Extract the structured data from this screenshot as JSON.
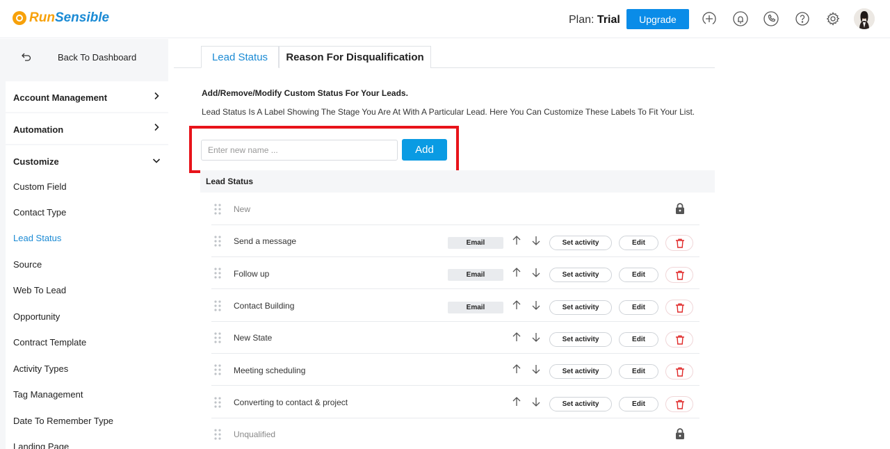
{
  "header": {
    "logo_run": "Run",
    "logo_sensible": "Sensible",
    "plan_label": "Plan:",
    "plan_value": "Trial",
    "upgrade_label": "Upgrade",
    "icons": [
      "add-circle-icon",
      "bell-icon",
      "phone-icon",
      "help-icon",
      "gear-icon"
    ]
  },
  "sidebar": {
    "back_label": "Back To Dashboard",
    "sections": [
      {
        "label": "Account Management",
        "expanded": false
      },
      {
        "label": "Automation",
        "expanded": false
      },
      {
        "label": "Customize",
        "expanded": true
      }
    ],
    "items": [
      {
        "label": "Custom Field",
        "active": false
      },
      {
        "label": "Contact Type",
        "active": false
      },
      {
        "label": "Lead Status",
        "active": true
      },
      {
        "label": "Source",
        "active": false
      },
      {
        "label": "Web To Lead",
        "active": false
      },
      {
        "label": "Opportunity",
        "active": false
      },
      {
        "label": "Contract Template",
        "active": false
      },
      {
        "label": "Activity Types",
        "active": false
      },
      {
        "label": "Tag Management",
        "active": false
      },
      {
        "label": "Date To Remember Type",
        "active": false
      },
      {
        "label": "Landing Page",
        "active": false
      }
    ]
  },
  "tabs": [
    {
      "label": "Lead Status",
      "active": true
    },
    {
      "label": "Reason For Disqualification",
      "active": false
    }
  ],
  "main": {
    "heading": "Add/Remove/Modify Custom Status For Your Leads.",
    "description": "Lead Status Is A Label Showing The Stage You Are At With A Particular Lead. Here You Can Customize These Labels To Fit Your List.",
    "input_placeholder": "Enter new name ...",
    "add_label": "Add",
    "list_title": "Lead Status",
    "email_label": "Email",
    "set_activity_label": "Set activity",
    "edit_label": "Edit",
    "accent_color": "#0a9be3",
    "highlight_color": "#e8131a"
  },
  "statuses": [
    {
      "name": "New",
      "locked": true,
      "email": false
    },
    {
      "name": "Send a message",
      "locked": false,
      "email": true
    },
    {
      "name": "Follow up",
      "locked": false,
      "email": true
    },
    {
      "name": "Contact Building",
      "locked": false,
      "email": true
    },
    {
      "name": "New State",
      "locked": false,
      "email": false
    },
    {
      "name": "Meeting scheduling",
      "locked": false,
      "email": false
    },
    {
      "name": "Converting to contact & project",
      "locked": false,
      "email": false
    },
    {
      "name": "Unqualified",
      "locked": true,
      "email": false
    }
  ]
}
